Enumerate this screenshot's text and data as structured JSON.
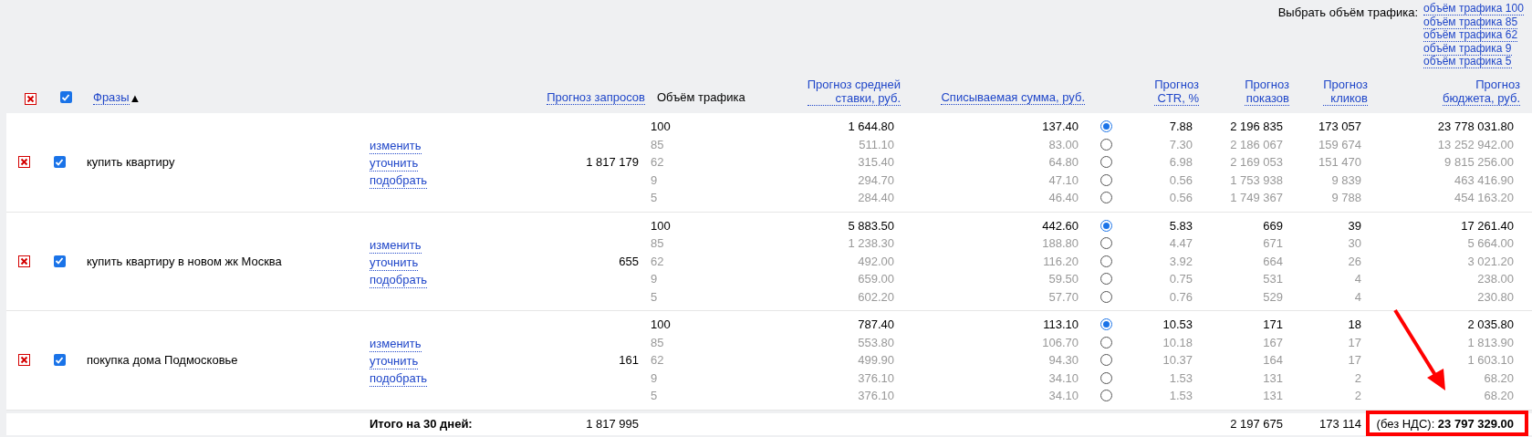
{
  "traffic_selector": {
    "label": "Выбрать объём трафика:",
    "options": [
      "объём трафика 100",
      "объём трафика 85",
      "объём трафика 62",
      "объём трафика 9",
      "объём трафика 5"
    ]
  },
  "table": {
    "select_all": {
      "checked": true
    },
    "headers": {
      "phrases": {
        "label": "Фразы",
        "link": true,
        "sort": "▲"
      },
      "requests": {
        "label": "Прогноз запросов",
        "link": true
      },
      "volume": {
        "label": "Объём трафика",
        "link": false
      },
      "bid": {
        "label": "Прогноз средней\nставки, руб.",
        "link": true
      },
      "charge": {
        "label": "Списываемая сумма, руб.",
        "link": true
      },
      "ctr": {
        "label": "Прогноз\nCTR, %",
        "link": true
      },
      "impressions": {
        "label": "Прогноз\nпоказов",
        "link": true
      },
      "clicks": {
        "label": "Прогноз\nкликов",
        "link": true
      },
      "budget": {
        "label": "Прогноз\nбюджета, руб.",
        "link": true
      }
    },
    "rows": [
      {
        "phrase": "купить квартиру",
        "checked": true,
        "actions": [
          "изменить",
          "уточнить",
          "подобрать"
        ],
        "requests": "1 817 179",
        "tiers": [
          {
            "volume": "100",
            "bid": "1 644.80",
            "charge": "137.40",
            "selected": true,
            "ctr": "7.88",
            "impressions": "2 196 835",
            "clicks": "173 057",
            "budget": "23 778 031.80"
          },
          {
            "volume": "85",
            "bid": "511.10",
            "charge": "83.00",
            "selected": false,
            "ctr": "7.30",
            "impressions": "2 186 067",
            "clicks": "159 674",
            "budget": "13 252 942.00"
          },
          {
            "volume": "62",
            "bid": "315.40",
            "charge": "64.80",
            "selected": false,
            "ctr": "6.98",
            "impressions": "2 169 053",
            "clicks": "151 470",
            "budget": "9 815 256.00"
          },
          {
            "volume": "9",
            "bid": "294.70",
            "charge": "47.10",
            "selected": false,
            "ctr": "0.56",
            "impressions": "1 753 938",
            "clicks": "9 839",
            "budget": "463 416.90"
          },
          {
            "volume": "5",
            "bid": "284.40",
            "charge": "46.40",
            "selected": false,
            "ctr": "0.56",
            "impressions": "1 749 367",
            "clicks": "9 788",
            "budget": "454 163.20"
          }
        ]
      },
      {
        "phrase": "купить квартиру в новом жк Москва",
        "checked": true,
        "actions": [
          "изменить",
          "уточнить",
          "подобрать"
        ],
        "requests": "655",
        "tiers": [
          {
            "volume": "100",
            "bid": "5 883.50",
            "charge": "442.60",
            "selected": true,
            "ctr": "5.83",
            "impressions": "669",
            "clicks": "39",
            "budget": "17 261.40"
          },
          {
            "volume": "85",
            "bid": "1 238.30",
            "charge": "188.80",
            "selected": false,
            "ctr": "4.47",
            "impressions": "671",
            "clicks": "30",
            "budget": "5 664.00"
          },
          {
            "volume": "62",
            "bid": "492.00",
            "charge": "116.20",
            "selected": false,
            "ctr": "3.92",
            "impressions": "664",
            "clicks": "26",
            "budget": "3 021.20"
          },
          {
            "volume": "9",
            "bid": "659.00",
            "charge": "59.50",
            "selected": false,
            "ctr": "0.75",
            "impressions": "531",
            "clicks": "4",
            "budget": "238.00"
          },
          {
            "volume": "5",
            "bid": "602.20",
            "charge": "57.70",
            "selected": false,
            "ctr": "0.76",
            "impressions": "529",
            "clicks": "4",
            "budget": "230.80"
          }
        ]
      },
      {
        "phrase": "покупка дома Подмосковье",
        "checked": true,
        "actions": [
          "изменить",
          "уточнить",
          "подобрать"
        ],
        "requests": "161",
        "tiers": [
          {
            "volume": "100",
            "bid": "787.40",
            "charge": "113.10",
            "selected": true,
            "ctr": "10.53",
            "impressions": "171",
            "clicks": "18",
            "budget": "2 035.80"
          },
          {
            "volume": "85",
            "bid": "553.80",
            "charge": "106.70",
            "selected": false,
            "ctr": "10.18",
            "impressions": "167",
            "clicks": "17",
            "budget": "1 813.90"
          },
          {
            "volume": "62",
            "bid": "499.90",
            "charge": "94.30",
            "selected": false,
            "ctr": "10.37",
            "impressions": "164",
            "clicks": "17",
            "budget": "1 603.10"
          },
          {
            "volume": "9",
            "bid": "376.10",
            "charge": "34.10",
            "selected": false,
            "ctr": "1.53",
            "impressions": "131",
            "clicks": "2",
            "budget": "68.20"
          },
          {
            "volume": "5",
            "bid": "376.10",
            "charge": "34.10",
            "selected": false,
            "ctr": "1.53",
            "impressions": "131",
            "clicks": "2",
            "budget": "68.20"
          }
        ]
      }
    ],
    "footer": {
      "label": "Итого на 30 дней:",
      "requests": "1 817 995",
      "impressions": "2 197 675",
      "clicks": "173 114",
      "budget": "(без НДС): **23 797 329.00**"
    }
  }
}
